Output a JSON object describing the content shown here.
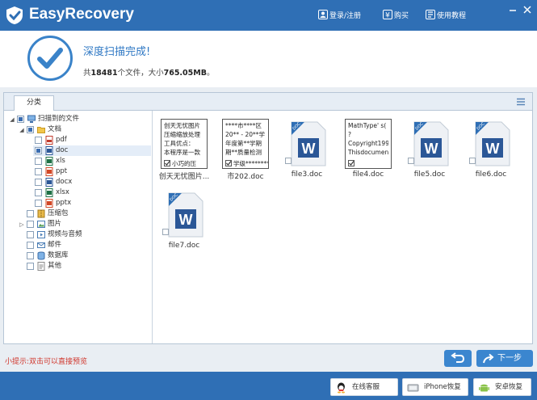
{
  "app": {
    "title": "EasyRecovery",
    "colors": {
      "titlebar": "#2f6fb5",
      "accent": "#3a83c9",
      "hint": "#d0352b"
    }
  },
  "header": {
    "links": [
      {
        "label": "登录/注册",
        "icon": "user-icon"
      },
      {
        "label": "购买",
        "icon": "yen-icon"
      },
      {
        "label": "使用教程",
        "icon": "book-icon"
      }
    ],
    "window_controls": [
      "minimize-icon",
      "close-icon"
    ]
  },
  "status": {
    "title": "深度扫描完成!",
    "prefix": "共",
    "file_count": "18481",
    "mid": "个文件，大小",
    "size": "765.05MB",
    "suffix": "。"
  },
  "tab": {
    "label": "分类"
  },
  "tree": [
    {
      "label": "扫描到的文件",
      "icon": "computer-icon"
    },
    {
      "label": "文档",
      "icon": "folder-icon"
    },
    {
      "label": "pdf",
      "icon": "pdf-icon"
    },
    {
      "label": "doc",
      "icon": "word-icon",
      "selected": true
    },
    {
      "label": "xls",
      "icon": "excel-icon"
    },
    {
      "label": "ppt",
      "icon": "ppt-icon"
    },
    {
      "label": "docx",
      "icon": "word-icon"
    },
    {
      "label": "xlsx",
      "icon": "excel-icon"
    },
    {
      "label": "pptx",
      "icon": "ppt-icon"
    },
    {
      "label": "压缩包",
      "icon": "archive-icon"
    },
    {
      "label": "图片",
      "icon": "image-icon"
    },
    {
      "label": "视频与音频",
      "icon": "media-icon"
    },
    {
      "label": "邮件",
      "icon": "mail-icon"
    },
    {
      "label": "数据库",
      "icon": "database-icon"
    },
    {
      "label": "其他",
      "icon": "other-icon"
    }
  ],
  "files": [
    {
      "name": "创天无忧图片...",
      "lines": [
        "创天无忧图片",
        "压缩缩放处理",
        "工具优点：",
        "本程序是一款"
      ],
      "tail": "小巧的压"
    },
    {
      "name": "市202.doc",
      "lines": [
        "****市****区",
        "20** - 20**学",
        "年度第**学期",
        "期**质量检测"
      ],
      "tail": "学级********"
    },
    {
      "name": "file3.doc"
    },
    {
      "name": "file4.doc",
      "lines": [
        "MathType' s(",
        "?",
        "Copyright199",
        "Thisdocument"
      ],
      "tail": ""
    },
    {
      "name": "file5.doc"
    },
    {
      "name": "file6.doc"
    },
    {
      "name": "file7.doc"
    }
  ],
  "footer": {
    "hint": "小提示:双击可以直接预览",
    "next_label": "下一步",
    "buttons": [
      {
        "label": "在线客服",
        "icon": "qq-icon"
      },
      {
        "label": "iPhone恢复",
        "icon": "iphone-icon"
      },
      {
        "label": "安卓恢复",
        "icon": "android-icon"
      }
    ]
  }
}
